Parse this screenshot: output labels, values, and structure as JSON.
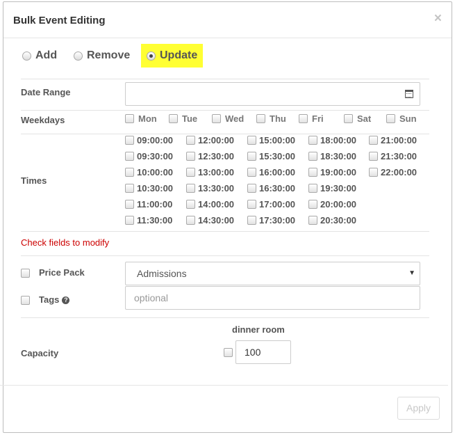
{
  "modal": {
    "title": "Bulk Event Editing",
    "close_label": "×"
  },
  "mode": {
    "add": "Add",
    "remove": "Remove",
    "update": "Update",
    "selected": "Update",
    "highlight_color": "#ffff33"
  },
  "date_range": {
    "label": "Date Range",
    "value": ""
  },
  "weekdays": {
    "label": "Weekdays",
    "days": [
      "Mon",
      "Tue",
      "Wed",
      "Thu",
      "Fri",
      "Sat",
      "Sun"
    ]
  },
  "times": {
    "label": "Times",
    "columns": [
      [
        "09:00:00",
        "09:30:00",
        "10:00:00",
        "10:30:00",
        "11:00:00",
        "11:30:00"
      ],
      [
        "12:00:00",
        "12:30:00",
        "13:00:00",
        "13:30:00",
        "14:00:00",
        "14:30:00"
      ],
      [
        "15:00:00",
        "15:30:00",
        "16:00:00",
        "16:30:00",
        "17:00:00",
        "17:30:00"
      ],
      [
        "18:00:00",
        "18:30:00",
        "19:00:00",
        "19:30:00",
        "20:00:00",
        "20:30:00"
      ],
      [
        "21:00:00",
        "21:30:00",
        "22:00:00"
      ]
    ]
  },
  "hint": {
    "text": "Check fields to modify",
    "color": "#cc0000"
  },
  "price_pack": {
    "label": "Price Pack",
    "value": "Admissions"
  },
  "tags": {
    "label": "Tags",
    "placeholder": "optional"
  },
  "capacity": {
    "label": "Capacity",
    "room": "dinner room",
    "value": "100"
  },
  "footer": {
    "apply": "Apply"
  }
}
